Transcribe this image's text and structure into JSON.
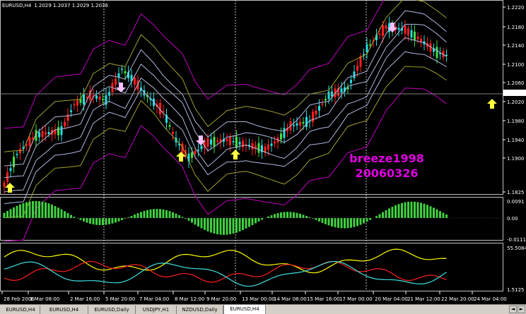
{
  "header": {
    "symbol": "EURUSD,H4",
    "ohlc": "1.2029 1.2037 1.2029 1.2036"
  },
  "watermark": {
    "line1": "breeze1998",
    "line2": "20060326"
  },
  "price_axis": {
    "labels": [
      "1.2220",
      "1.2180",
      "1.2140",
      "1.2100",
      "1.2060",
      "1.2020",
      "1.1980",
      "1.1940",
      "1.1900",
      "1.1825"
    ],
    "current": "1.2036"
  },
  "osc_axis": {
    "labels": [
      "0.0091",
      "0.00",
      "-0.0111"
    ]
  },
  "rsi_axis": {
    "labels": [
      "55.5084",
      "1.5125"
    ]
  },
  "time_axis": {
    "labels": [
      "28 Feb 2006",
      "1 Mar 08:00",
      "2 Mar 16:00",
      "5 Mar 20:00",
      "7 Mar 04:00",
      "8 Mar 12:00",
      "9 Mar 20:00",
      "13 Mar 00:00",
      "14 Mar 08:00",
      "15 Mar 16:00",
      "17 Mar 00:00",
      "20 Mar 04:00",
      "21 Mar 12:00",
      "22 Mar 20:00",
      "24 Mar 04:00"
    ]
  },
  "tabs": [
    {
      "label": "EURUSD,H4",
      "active": false
    },
    {
      "label": "EURUSD,H4",
      "active": false
    },
    {
      "label": "EURUSD,Daily",
      "active": false
    },
    {
      "label": "USDJPY,H1",
      "active": false
    },
    {
      "label": "NZDUSD,Daily",
      "active": false
    },
    {
      "label": "EURUSD,H4",
      "active": true
    }
  ],
  "nav": {
    "prev": "◄",
    "next": "►"
  },
  "colors": {
    "background": "#000000",
    "bull_candle": "#ff2020",
    "bear_candle": "#20e0e0",
    "neutral_candle": "#40e040",
    "arrow_up": "#ffff40",
    "arrow_down": "#ffc0ff",
    "bands_outer": "#c000c0",
    "bands_mid": "#a0a030",
    "bands_inner": "#b0b8e0",
    "osc_bar": "#40d040",
    "line_yellow": "#ffff00",
    "line_red": "#ff2020",
    "line_cyan": "#40e0e0"
  }
}
